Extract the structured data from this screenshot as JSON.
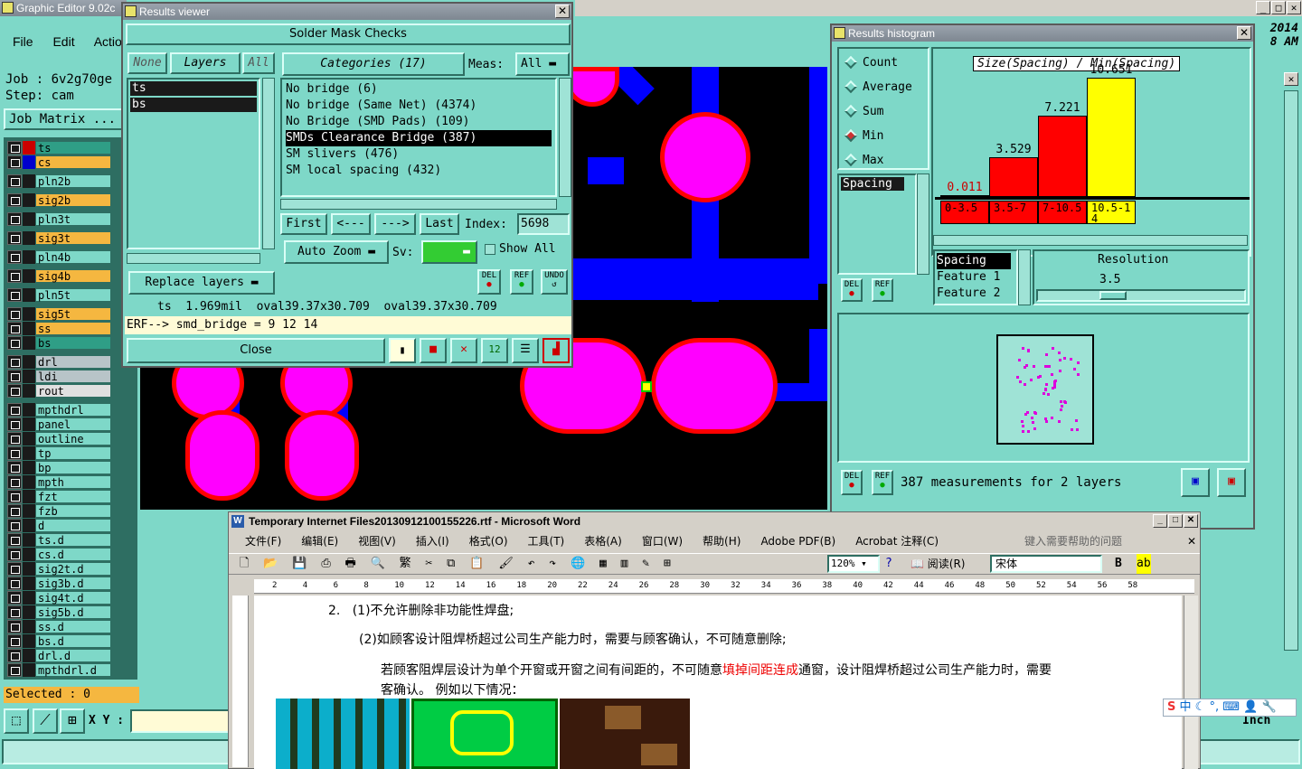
{
  "main_window": {
    "title": "Graphic Editor 9.02c",
    "menu": [
      "File",
      "Edit",
      "Actio"
    ],
    "clock": [
      "2014",
      "8 AM"
    ],
    "job_label": "Job : 6v2g70ge",
    "step_label": "Step: cam",
    "job_matrix_button": "Job Matrix ...",
    "layers": [
      {
        "name": "ts",
        "color": "#2f9e86"
      },
      {
        "name": "cs",
        "color": "#f5b740"
      },
      {
        "name": "pln2b",
        "color": "#7ed8c8"
      },
      {
        "name": "sig2b",
        "color": "#f5b740"
      },
      {
        "name": "pln3t",
        "color": "#7ed8c8"
      },
      {
        "name": "sig3t",
        "color": "#f5b740"
      },
      {
        "name": "pln4b",
        "color": "#7ed8c8"
      },
      {
        "name": "sig4b",
        "color": "#f5b740"
      },
      {
        "name": "pln5t",
        "color": "#7ed8c8"
      },
      {
        "name": "sig5t",
        "color": "#f5b740"
      },
      {
        "name": "ss",
        "color": "#f5b740"
      },
      {
        "name": "bs",
        "color": "#2f9e86"
      },
      {
        "name": "drl",
        "color": "#b8c4c8"
      },
      {
        "name": "ldi",
        "color": "#b8c4c8"
      },
      {
        "name": "rout",
        "color": "#e0e0e0"
      },
      {
        "name": "mpthdrl",
        "color": "#7ed8c8"
      },
      {
        "name": "panel",
        "color": "#7ed8c8"
      },
      {
        "name": "outline",
        "color": "#7ed8c8"
      },
      {
        "name": "tp",
        "color": "#7ed8c8"
      },
      {
        "name": "bp",
        "color": "#7ed8c8"
      },
      {
        "name": "mpth",
        "color": "#7ed8c8"
      },
      {
        "name": "fzt",
        "color": "#7ed8c8"
      },
      {
        "name": "fzb",
        "color": "#7ed8c8"
      },
      {
        "name": "d",
        "color": "#7ed8c8"
      },
      {
        "name": "ts.d",
        "color": "#7ed8c8"
      },
      {
        "name": "cs.d",
        "color": "#7ed8c8"
      },
      {
        "name": "sig2t.d",
        "color": "#7ed8c8"
      },
      {
        "name": "sig3b.d",
        "color": "#7ed8c8"
      },
      {
        "name": "sig4t.d",
        "color": "#7ed8c8"
      },
      {
        "name": "sig5b.d",
        "color": "#7ed8c8"
      },
      {
        "name": "ss.d",
        "color": "#7ed8c8"
      },
      {
        "name": "bs.d",
        "color": "#7ed8c8"
      },
      {
        "name": "drl.d",
        "color": "#7ed8c8"
      },
      {
        "name": "mpthdrl.d",
        "color": "#7ed8c8"
      }
    ],
    "selected_label": "Selected : 0",
    "xy_label": "X Y :",
    "units": "Inch"
  },
  "results_viewer": {
    "title": "Results viewer",
    "header": "Solder Mask Checks",
    "none_btn": "None",
    "layers_btn": "Layers",
    "all_btn": "All",
    "categories_btn": "Categories (17)",
    "meas_label": "Meas:",
    "meas_value": "All",
    "layers": [
      "ts",
      "bs"
    ],
    "categories": [
      "No bridge (6)",
      "No bridge (Same Net) (4374)",
      "No Bridge (SMD Pads) (109)",
      "SMDs Clearance Bridge (387)",
      "SM slivers (476)",
      "SM local spacing (432)"
    ],
    "selected_category": 3,
    "first_btn": "First",
    "prev_btn": "<---",
    "next_btn": "--->",
    "last_btn": "Last",
    "index_label": "Index:",
    "index_value": "5698",
    "auto_zoom": "Auto Zoom",
    "sv_label": "Sv:",
    "show_all": "Show All",
    "replace_layers": "Replace layers",
    "del": "DEL",
    "ref": "REF",
    "undo": "UNDO",
    "status": "ts  1.969mil  oval39.37x30.709  oval39.37x30.709",
    "erf": "ERF--> smd_bridge = 9 12 14",
    "close_btn": "Close"
  },
  "histogram": {
    "title": "Results histogram",
    "modes": [
      "Count",
      "Average",
      "Sum",
      "Min",
      "Max"
    ],
    "selected_mode": "Min",
    "chart_title": "Size(Spacing) / Min(Spacing)",
    "list_item": "Spacing",
    "bars": [
      {
        "range": "0-3.5",
        "value": "0.011",
        "color": "#ff0000"
      },
      {
        "range": "3.5-7",
        "value": "3.529",
        "color": "#ff0000"
      },
      {
        "range": "7-10.5",
        "value": "7.221",
        "color": "#ff0000"
      },
      {
        "range": "10.5-14",
        "value": "10.651",
        "color": "#ffff00"
      }
    ],
    "bar_fractions": [
      0.01,
      0.33,
      0.68,
      1.0
    ],
    "res_list": [
      "Spacing",
      "Feature 1",
      "Feature 2"
    ],
    "resolution_label": "Resolution",
    "resolution_value": "3.5",
    "summary": "387 measurements for 2 layers",
    "del": "DEL",
    "ref": "REF"
  },
  "word": {
    "title": "Temporary Internet Files20130912100155226.rtf - Microsoft Word",
    "menu": [
      "文件(F)",
      "编辑(E)",
      "视图(V)",
      "插入(I)",
      "格式(O)",
      "工具(T)",
      "表格(A)",
      "窗口(W)",
      "帮助(H)",
      "Adobe PDF(B)",
      "Acrobat 注释(C)"
    ],
    "help_box": "键入需要帮助的问题",
    "zoom": "120%",
    "reading": "阅读(R)",
    "font": "宋体",
    "bold": "B",
    "ruler_marks": [
      "2",
      "4",
      "6",
      "8",
      "10",
      "12",
      "14",
      "16",
      "18",
      "20",
      "22",
      "24",
      "26",
      "28",
      "30",
      "32",
      "34",
      "36",
      "38",
      "40",
      "42",
      "44",
      "46",
      "48",
      "50",
      "52",
      "54",
      "56",
      "58"
    ],
    "line1": "2.   (1)不允许删除非功能性焊盘;",
    "line2": "(2)如顾客设计阻焊桥超过公司生产能力时，需要与顾客确认，不可随意删除;",
    "line3a": "若顾客阻焊层设计为单个开窗或开窗之间有间距的，不可随意",
    "line3b": "填掉间距连成",
    "line3c": "通窗，设计阻焊桥超过公司生产能力时，需要",
    "line4": "客确认。 例如以下情况：",
    "ime": "中"
  }
}
